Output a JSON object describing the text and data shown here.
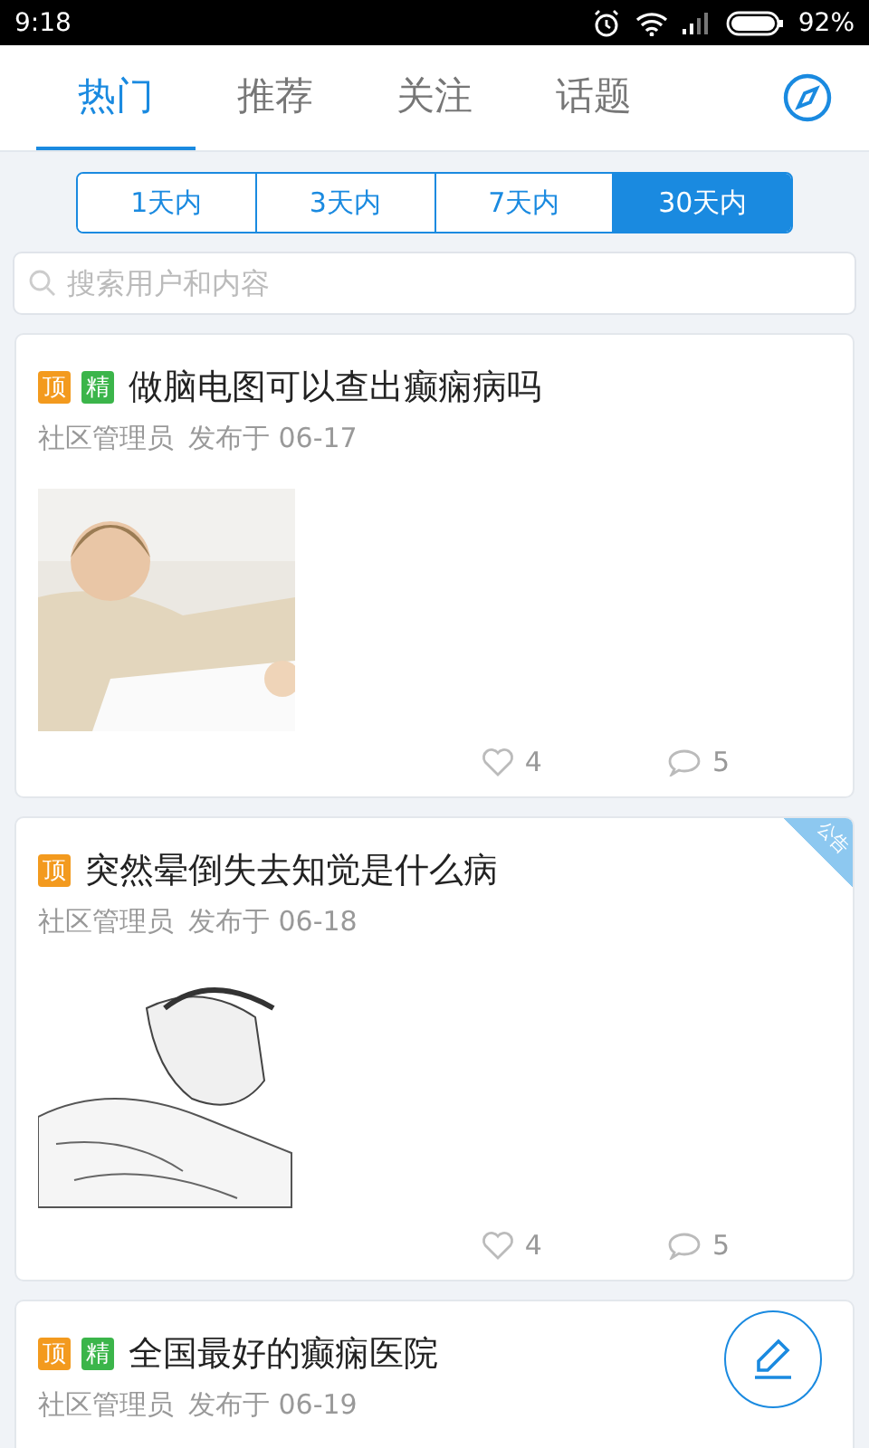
{
  "status_bar": {
    "time": "9:18",
    "battery": "92%"
  },
  "tabs": [
    {
      "label": "热门",
      "selected": true
    },
    {
      "label": "推荐",
      "selected": false
    },
    {
      "label": "关注",
      "selected": false
    },
    {
      "label": "话题",
      "selected": false
    }
  ],
  "periods": [
    {
      "label": "1天内",
      "selected": false
    },
    {
      "label": "3天内",
      "selected": false
    },
    {
      "label": "7天内",
      "selected": false
    },
    {
      "label": "30天内",
      "selected": true
    }
  ],
  "search": {
    "placeholder": "搜索用户和内容"
  },
  "posts": [
    {
      "badges": [
        {
          "kind": "top",
          "label": "顶"
        },
        {
          "kind": "essence",
          "label": "精"
        }
      ],
      "title": "做脑电图可以查出癫痫病吗",
      "author": "社区管理员",
      "published": "发布于",
      "date": "06-17",
      "image": {
        "kind": "picture"
      },
      "likes": "4",
      "comments": "5"
    },
    {
      "badges": [
        {
          "kind": "top",
          "label": "顶"
        }
      ],
      "ribbon": "公告",
      "title": "突然晕倒失去知觉是什么病",
      "author": "社区管理员",
      "published": "发布于",
      "date": "06-18",
      "image": {
        "kind": "picture"
      },
      "likes": "4",
      "comments": "5"
    },
    {
      "badges": [
        {
          "kind": "top",
          "label": "顶"
        },
        {
          "kind": "essence",
          "label": "精"
        }
      ],
      "title": "全国最好的癫痫医院",
      "author": "社区管理员",
      "published": "发布于",
      "date": "06-19"
    }
  ]
}
